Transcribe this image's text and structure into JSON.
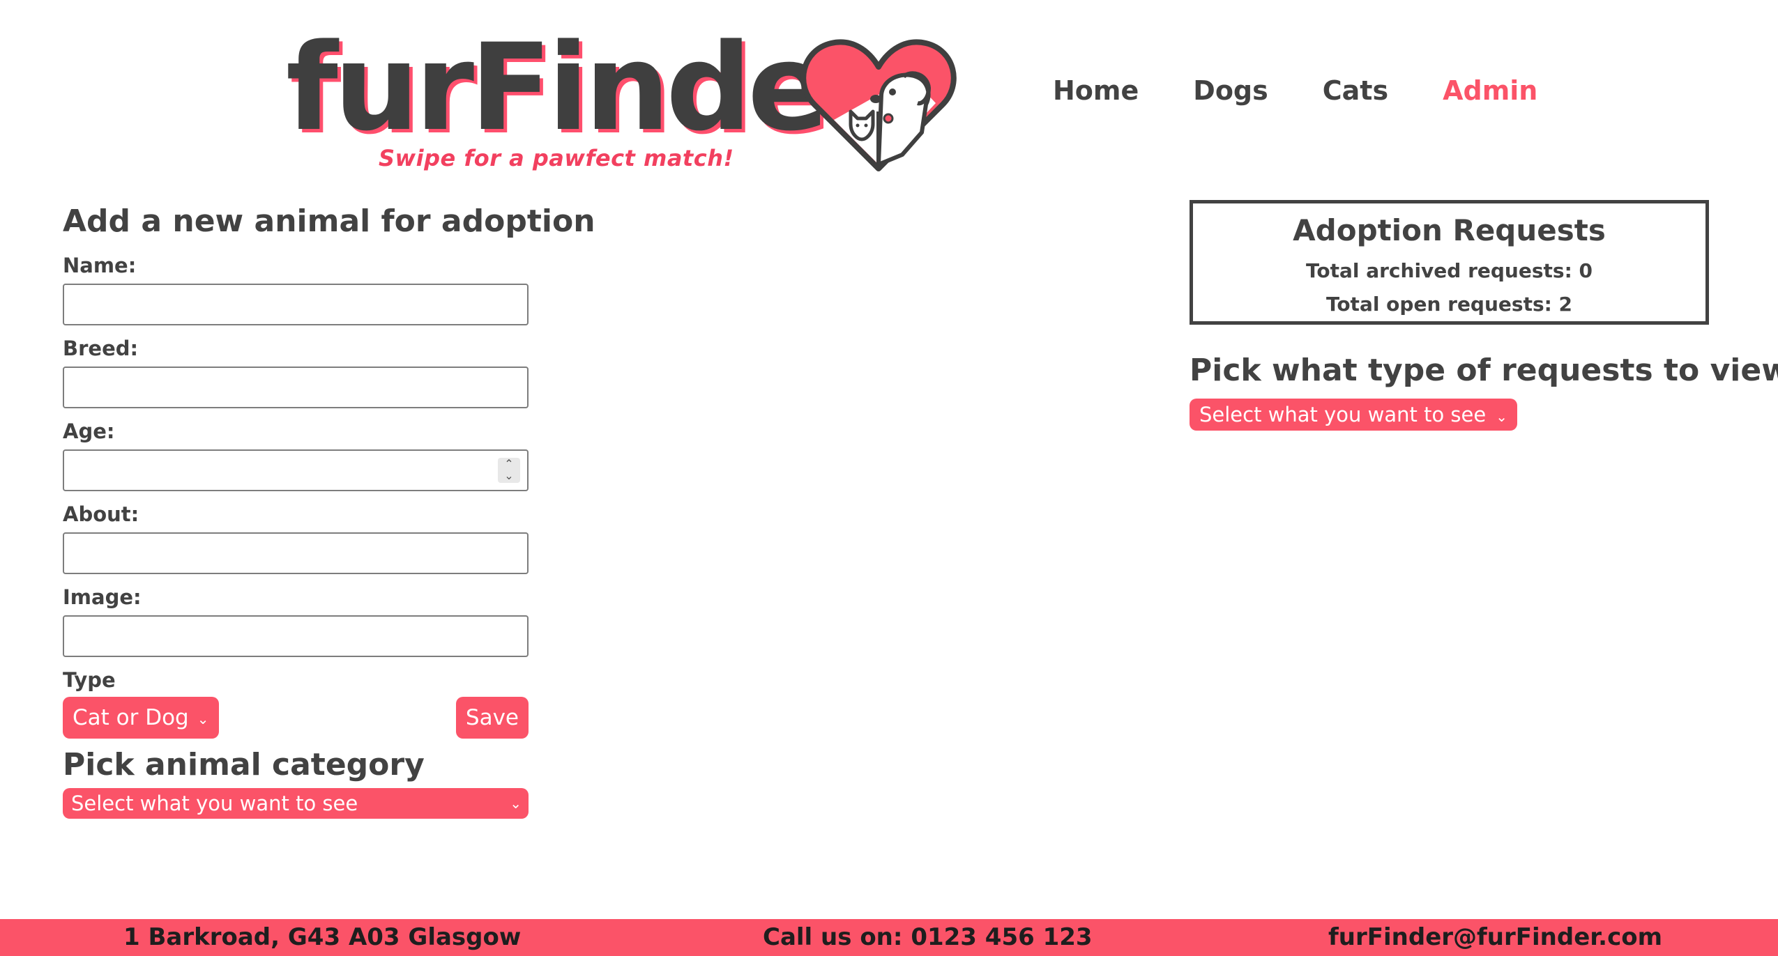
{
  "brand": {
    "name": "furFinder",
    "tagline": "Swipe for a pawfect match!",
    "accent_color": "#fb5368",
    "logo_icon": "heart-dog-cat-icon"
  },
  "nav": {
    "items": [
      {
        "label": "Home",
        "active": false
      },
      {
        "label": "Dogs",
        "active": false
      },
      {
        "label": "Cats",
        "active": false
      },
      {
        "label": "Admin",
        "active": true
      }
    ]
  },
  "add_form": {
    "title": "Add a new animal for adoption",
    "name_label": "Name:",
    "name_value": "",
    "breed_label": "Breed:",
    "breed_value": "",
    "age_label": "Age:",
    "age_value": "",
    "about_label": "About:",
    "about_value": "",
    "image_label": "Image:",
    "image_value": "",
    "type_label": "Type",
    "type_select": "Cat or Dog",
    "save_label": "Save"
  },
  "category": {
    "title": "Pick animal category",
    "select": "Select what you want to see"
  },
  "requests": {
    "title": "Adoption Requests",
    "archived": "Total archived requests: 0",
    "open": "Total open requests: 2",
    "pick_title": "Pick what type of requests to view",
    "select": "Select what you want to see"
  },
  "footer": {
    "address": "1 Barkroad, G43 A03 Glasgow",
    "phone": "Call us on: 0123 456 123",
    "email": "furFinder@furFinder.com"
  }
}
